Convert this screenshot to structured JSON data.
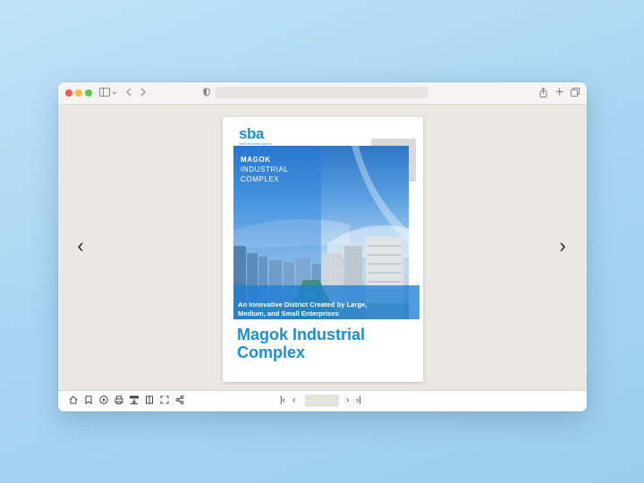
{
  "browser": {
    "controls": {
      "close_color": "#ee5b54",
      "minimize_color": "#f4bd3a",
      "maximize_color": "#5ec845"
    },
    "icons": {
      "sidebar": "sidebar-icon",
      "chevron": "chevron-down-icon",
      "back": "back-icon",
      "forward": "forward-icon",
      "shield": "shield-icon",
      "share": "share-icon",
      "new_tab": "plus-icon",
      "tabs": "tabs-icon"
    },
    "url": ""
  },
  "viewer": {
    "prev_glyph": "‹",
    "next_glyph": "›",
    "page": {
      "logo_text": "sba",
      "logo_subtitle": "Seoul Business Agency",
      "small_title_line1": "MAGOK",
      "small_title_line2": "INDUSTRIAL",
      "small_title_line3": "COMPLEX",
      "tagline_line1": "An Innovative District Created by Large,",
      "tagline_line2": "Medium, and Small Enterprises",
      "title_line1": "Magok Industrial",
      "title_line2": "Complex",
      "accent_color": "#1a8fd8"
    }
  },
  "toolbar": {
    "icons": [
      "home-icon",
      "bookmark-icon",
      "play-icon",
      "print-icon",
      "pdf-download-icon",
      "single-page-icon",
      "fullscreen-icon",
      "share-icon"
    ],
    "first_page_glyph": "|‹",
    "prev_page_glyph": "‹",
    "next_page_glyph": "›",
    "last_page_glyph": "›|",
    "page_value": ""
  }
}
